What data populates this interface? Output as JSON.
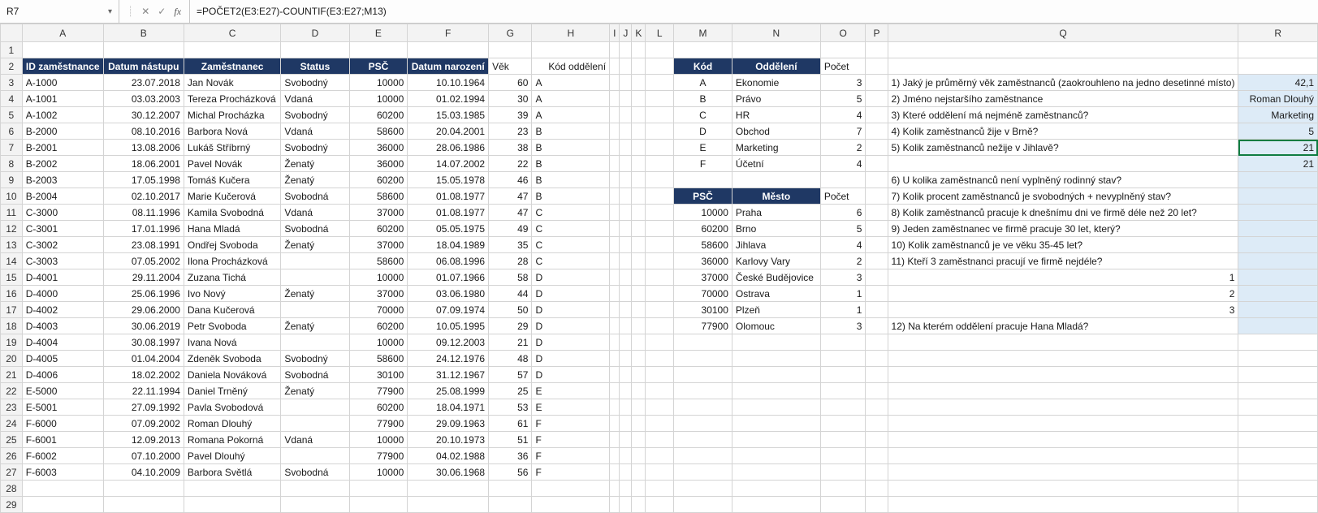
{
  "nameBox": "R7",
  "formula": "=POČET2(E3:E27)-COUNTIF(E3:E27;M13)",
  "columns": [
    "A",
    "B",
    "C",
    "D",
    "E",
    "F",
    "G",
    "H",
    "I",
    "J",
    "K",
    "L",
    "M",
    "N",
    "O",
    "P",
    "Q",
    "R"
  ],
  "chart_data": {
    "type": "table",
    "employees_header": {
      "A": "ID zaměstnance",
      "B": "Datum nástupu",
      "C": "Zaměstnanec",
      "D": "Status",
      "E": "PSČ",
      "F": "Datum narození",
      "G": "Věk",
      "H": "Kód oddělení"
    },
    "employees": [
      {
        "id": "A-1000",
        "hire": "23.07.2018",
        "name": "Jan Novák",
        "status": "Svobodný",
        "psc": "10000",
        "dob": "10.10.1964",
        "age": 60,
        "dept": "A"
      },
      {
        "id": "A-1001",
        "hire": "03.03.2003",
        "name": "Tereza Procházková",
        "status": "Vdaná",
        "psc": "10000",
        "dob": "01.02.1994",
        "age": 30,
        "dept": "A"
      },
      {
        "id": "A-1002",
        "hire": "30.12.2007",
        "name": "Michal Procházka",
        "status": "Svobodný",
        "psc": "60200",
        "dob": "15.03.1985",
        "age": 39,
        "dept": "A"
      },
      {
        "id": "B-2000",
        "hire": "08.10.2016",
        "name": "Barbora Nová",
        "status": "Vdaná",
        "psc": "58600",
        "dob": "20.04.2001",
        "age": 23,
        "dept": "B"
      },
      {
        "id": "B-2001",
        "hire": "13.08.2006",
        "name": "Lukáš Stříbrný",
        "status": "Svobodný",
        "psc": "36000",
        "dob": "28.06.1986",
        "age": 38,
        "dept": "B"
      },
      {
        "id": "B-2002",
        "hire": "18.06.2001",
        "name": "Pavel Novák",
        "status": "Ženatý",
        "psc": "36000",
        "dob": "14.07.2002",
        "age": 22,
        "dept": "B"
      },
      {
        "id": "B-2003",
        "hire": "17.05.1998",
        "name": "Tomáš Kučera",
        "status": "Ženatý",
        "psc": "60200",
        "dob": "15.05.1978",
        "age": 46,
        "dept": "B"
      },
      {
        "id": "B-2004",
        "hire": "02.10.2017",
        "name": "Marie Kučerová",
        "status": "Svobodná",
        "psc": "58600",
        "dob": "01.08.1977",
        "age": 47,
        "dept": "B"
      },
      {
        "id": "C-3000",
        "hire": "08.11.1996",
        "name": "Kamila Svobodná",
        "status": "Vdaná",
        "psc": "37000",
        "dob": "01.08.1977",
        "age": 47,
        "dept": "C"
      },
      {
        "id": "C-3001",
        "hire": "17.01.1996",
        "name": "Hana Mladá",
        "status": "Svobodná",
        "psc": "60200",
        "dob": "05.05.1975",
        "age": 49,
        "dept": "C"
      },
      {
        "id": "C-3002",
        "hire": "23.08.1991",
        "name": "Ondřej Svoboda",
        "status": "Ženatý",
        "psc": "37000",
        "dob": "18.04.1989",
        "age": 35,
        "dept": "C"
      },
      {
        "id": "C-3003",
        "hire": "07.05.2002",
        "name": "Ilona Procházková",
        "status": "",
        "psc": "58600",
        "dob": "06.08.1996",
        "age": 28,
        "dept": "C"
      },
      {
        "id": "D-4001",
        "hire": "29.11.2004",
        "name": "Zuzana Tichá",
        "status": "",
        "psc": "10000",
        "dob": "01.07.1966",
        "age": 58,
        "dept": "D"
      },
      {
        "id": "D-4000",
        "hire": "25.06.1996",
        "name": "Ivo Nový",
        "status": "Ženatý",
        "psc": "37000",
        "dob": "03.06.1980",
        "age": 44,
        "dept": "D"
      },
      {
        "id": "D-4002",
        "hire": "29.06.2000",
        "name": "Dana Kučerová",
        "status": "",
        "psc": "70000",
        "dob": "07.09.1974",
        "age": 50,
        "dept": "D"
      },
      {
        "id": "D-4003",
        "hire": "30.06.2019",
        "name": "Petr Svoboda",
        "status": "Ženatý",
        "psc": "60200",
        "dob": "10.05.1995",
        "age": 29,
        "dept": "D"
      },
      {
        "id": "D-4004",
        "hire": "30.08.1997",
        "name": "Ivana Nová",
        "status": "",
        "psc": "10000",
        "dob": "09.12.2003",
        "age": 21,
        "dept": "D"
      },
      {
        "id": "D-4005",
        "hire": "01.04.2004",
        "name": "Zdeněk Svoboda",
        "status": "Svobodný",
        "psc": "58600",
        "dob": "24.12.1976",
        "age": 48,
        "dept": "D"
      },
      {
        "id": "D-4006",
        "hire": "18.02.2002",
        "name": "Daniela Nováková",
        "status": "Svobodná",
        "psc": "30100",
        "dob": "31.12.1967",
        "age": 57,
        "dept": "D"
      },
      {
        "id": "E-5000",
        "hire": "22.11.1994",
        "name": "Daniel Trněný",
        "status": "Ženatý",
        "psc": "77900",
        "dob": "25.08.1999",
        "age": 25,
        "dept": "E"
      },
      {
        "id": "E-5001",
        "hire": "27.09.1992",
        "name": "Pavla Svobodová",
        "status": "",
        "psc": "60200",
        "dob": "18.04.1971",
        "age": 53,
        "dept": "E"
      },
      {
        "id": "F-6000",
        "hire": "07.09.2002",
        "name": "Roman Dlouhý",
        "status": "",
        "psc": "77900",
        "dob": "29.09.1963",
        "age": 61,
        "dept": "F"
      },
      {
        "id": "F-6001",
        "hire": "12.09.2013",
        "name": "Romana Pokorná",
        "status": "Vdaná",
        "psc": "10000",
        "dob": "20.10.1973",
        "age": 51,
        "dept": "F"
      },
      {
        "id": "F-6002",
        "hire": "07.10.2000",
        "name": "Pavel Dlouhý",
        "status": "",
        "psc": "77900",
        "dob": "04.02.1988",
        "age": 36,
        "dept": "F"
      },
      {
        "id": "F-6003",
        "hire": "04.10.2009",
        "name": "Barbora Světlá",
        "status": "Svobodná",
        "psc": "10000",
        "dob": "30.06.1968",
        "age": 56,
        "dept": "F"
      }
    ],
    "dept_header": {
      "M": "Kód",
      "N": "Oddělení",
      "O": "Počet"
    },
    "departments": [
      {
        "code": "A",
        "name": "Ekonomie",
        "count": 3
      },
      {
        "code": "B",
        "name": "Právo",
        "count": 5
      },
      {
        "code": "C",
        "name": "HR",
        "count": 4
      },
      {
        "code": "D",
        "name": "Obchod",
        "count": 7
      },
      {
        "code": "E",
        "name": "Marketing",
        "count": 2
      },
      {
        "code": "F",
        "name": "Účetní",
        "count": 4
      }
    ],
    "city_header": {
      "M": "PSČ",
      "N": "Město",
      "O": "Počet"
    },
    "cities": [
      {
        "psc": "10000",
        "name": "Praha",
        "count": 6
      },
      {
        "psc": "60200",
        "name": "Brno",
        "count": 5
      },
      {
        "psc": "58600",
        "name": "Jihlava",
        "count": 4
      },
      {
        "psc": "36000",
        "name": "Karlovy Vary",
        "count": 2
      },
      {
        "psc": "37000",
        "name": "České Budějovice",
        "count": 3
      },
      {
        "psc": "70000",
        "name": "Ostrava",
        "count": 1
      },
      {
        "psc": "30100",
        "name": "Plzeň",
        "count": 1
      },
      {
        "psc": "77900",
        "name": "Olomouc",
        "count": 3
      }
    ],
    "questions": [
      {
        "row": 3,
        "q": "1) Jaký je průměrný věk zaměstnanců (zaokrouhleno na jedno desetinné místo)",
        "a": "42,1",
        "answered": true
      },
      {
        "row": 4,
        "q": "2) Jméno nejstaršího zaměstnance",
        "a": "Roman Dlouhý",
        "answered": true
      },
      {
        "row": 5,
        "q": "3) Které oddělení má nejméně zaměstnanců?",
        "a": "Marketing",
        "answered": true
      },
      {
        "row": 6,
        "q": "4) Kolik zaměstnanců žije v Brně?",
        "a": "5",
        "answered": true
      },
      {
        "row": 7,
        "q": "5) Kolik zaměstnanců nežije v Jihlavě?",
        "a": "21",
        "answered": true
      },
      {
        "row": 8,
        "q": "",
        "a": "21",
        "answered": true
      },
      {
        "row": 9,
        "q": "6) U kolika zaměstnanců není vyplněný rodinný stav?",
        "a": "",
        "answered": true
      },
      {
        "row": 10,
        "q": "7) Kolik procent zaměstnanců je svobodných + nevyplněný stav?",
        "a": "",
        "answered": true
      },
      {
        "row": 11,
        "q": "8) Kolik zaměstnanců pracuje k dnešnímu dni ve firmě déle než 20 let?",
        "a": "",
        "answered": true
      },
      {
        "row": 12,
        "q": "9) Jeden zaměstnanec ve firmě pracuje 30 let, který?",
        "a": "",
        "answered": true
      },
      {
        "row": 13,
        "q": "10) Kolik zaměstnanců je ve věku 35-45 let?",
        "a": "",
        "answered": true
      },
      {
        "row": 14,
        "q": "11) Kteří 3 zaměstnanci pracují ve firmě nejdéle?",
        "a": "",
        "answered": true
      },
      {
        "row": 15,
        "q": "1",
        "a": "",
        "answered": true,
        "right": true
      },
      {
        "row": 16,
        "q": "2",
        "a": "",
        "answered": true,
        "right": true
      },
      {
        "row": 17,
        "q": "3",
        "a": "",
        "answered": true,
        "right": true
      },
      {
        "row": 18,
        "q": "12) Na kterém oddělení pracuje Hana Mladá?",
        "a": "",
        "answered": true
      }
    ]
  },
  "colWidths": {
    "A": 100,
    "B": 100,
    "C": 120,
    "D": 90,
    "E": 80,
    "F": 100,
    "G": 60,
    "H": 100,
    "I": 6,
    "J": 6,
    "K": 6,
    "L": 40,
    "M": 80,
    "N": 110,
    "O": 60,
    "P": 30,
    "Q": 400,
    "R": 100
  },
  "totalRows": 29,
  "selectedCell": {
    "row": 7,
    "col": "R"
  }
}
